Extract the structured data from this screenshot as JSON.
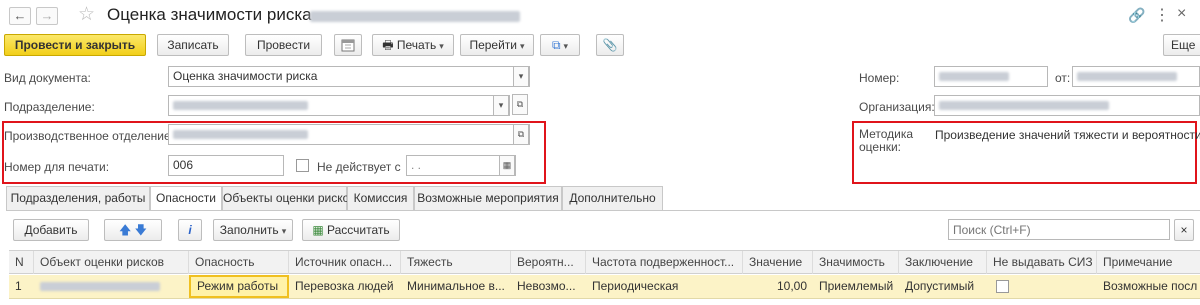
{
  "window": {
    "title": "Оценка значимости риска",
    "nav_back": "←",
    "nav_forward": "→",
    "star": "☆",
    "link_icon": "🔗",
    "more_icon": "⋮",
    "close_icon": "×"
  },
  "toolbar": {
    "post_close": "Провести и закрыть",
    "save": "Записать",
    "post": "Провести",
    "print": "Печать",
    "goto": "Перейти",
    "more": "Еще"
  },
  "form": {
    "doc_type_label": "Вид документа:",
    "doc_type_value": "Оценка значимости риска",
    "division_label": "Подразделение:",
    "prod_dept_label": "Производственное отделение:",
    "print_number_label": "Номер для печати:",
    "print_number_value": "006",
    "not_valid_label": "Не действует с",
    "not_valid_value": " .  .",
    "number_label": "Номер:",
    "from_label": "от:",
    "organization_label": "Организация:",
    "method_label": "Методика оценки:",
    "method_value": "Произведение значений тяжести и вероятности"
  },
  "tabs": [
    {
      "label": "Подразделения, работы"
    },
    {
      "label": "Опасности"
    },
    {
      "label": "Объекты оценки рисков"
    },
    {
      "label": "Комиссия"
    },
    {
      "label": "Возможные мероприятия"
    },
    {
      "label": "Дополнительно"
    }
  ],
  "grid_toolbar": {
    "add": "Добавить",
    "info": "i",
    "fill": "Заполнить",
    "calculate": "Рассчитать",
    "search_placeholder": "Поиск (Ctrl+F)",
    "clear": "×"
  },
  "table": {
    "columns": [
      "N",
      "Объект оценки рисков",
      "Опасность",
      "Источник опасн...",
      "Тяжесть",
      "Вероятн...",
      "Частота подверженност...",
      "Значение",
      "Значимость",
      "Заключение",
      "Не выдавать СИЗ",
      "Примечание"
    ],
    "rows": [
      {
        "n": "1",
        "hazard": "Режим работы",
        "source": "Перевозка людей",
        "severity": "Минимальное в...",
        "probability": "Невозмо...",
        "frequency": "Периодическая",
        "value": "10,00",
        "significance": "Приемлемый",
        "conclusion": "Допустимый",
        "note": "Возможные посл"
      }
    ]
  },
  "colors": {
    "primary_button": "#f2cf1a",
    "highlight_red": "#e0141b",
    "row_selected": "#fcf3c7"
  }
}
